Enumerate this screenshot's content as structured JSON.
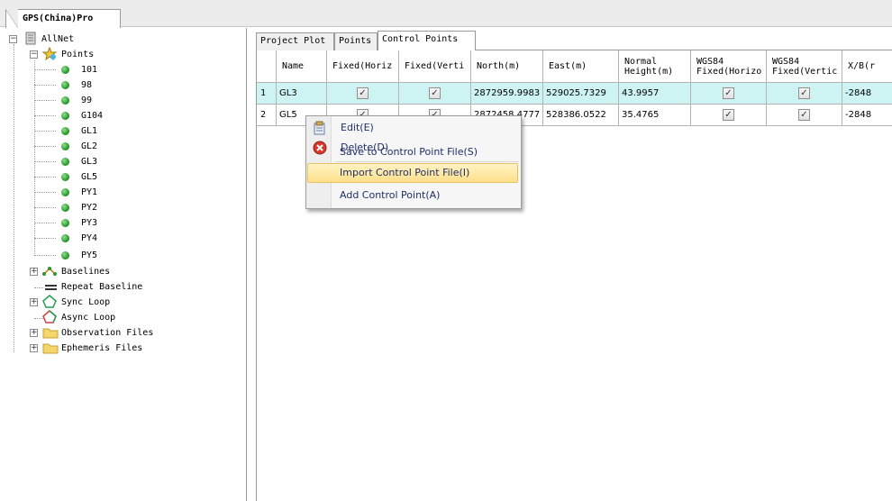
{
  "document_tab": {
    "label": "GPS(China)Pro"
  },
  "tree": {
    "root": "AllNet",
    "points_label": "Points",
    "points": [
      "101",
      "98",
      "99",
      "G104",
      "GL1",
      "GL2",
      "GL3",
      "GL5",
      "PY1",
      "PY2",
      "PY3",
      "PY4",
      "PY5"
    ],
    "baselines": "Baselines",
    "repeat_baseline": "Repeat Baseline",
    "sync_loop": "Sync Loop",
    "async_loop": "Async Loop",
    "observation_files": "Observation Files",
    "ephemeris_files": "Ephemeris Files"
  },
  "pane_tabs": [
    "Project Plot",
    "Points",
    "Control Points"
  ],
  "active_tab": "Control Points",
  "grid": {
    "columns": [
      {
        "line1": "Name",
        "line2": ""
      },
      {
        "line1": "Fixed(Horiz",
        "line2": ""
      },
      {
        "line1": "Fixed(Verti",
        "line2": ""
      },
      {
        "line1": "North(m)",
        "line2": ""
      },
      {
        "line1": "East(m)",
        "line2": ""
      },
      {
        "line1": "Normal",
        "line2": "Height(m)"
      },
      {
        "line1": "WGS84",
        "line2": "Fixed(Horizo"
      },
      {
        "line1": "WGS84",
        "line2": "Fixed(Vertic"
      },
      {
        "line1": "X/B(r",
        "line2": ""
      }
    ],
    "rows": [
      {
        "num": "1",
        "name": "GL3",
        "north": "2872959.9983",
        "east": "529025.7329",
        "height": "43.9957",
        "x": "-2848",
        "fixed_h": true,
        "fixed_v": true,
        "wgs_h": true,
        "wgs_v": true,
        "selected": true
      },
      {
        "num": "2",
        "name": "GL5",
        "north": "2872458.4777",
        "east": "528386.0522",
        "height": "35.4765",
        "x": "-2848",
        "fixed_h": true,
        "fixed_v": true,
        "wgs_h": true,
        "wgs_v": true,
        "selected": false
      }
    ]
  },
  "context_menu": {
    "edit": "Edit(E)",
    "delete": "Delete(D)",
    "save": "Save to Control Point File(S)",
    "import": "Import Control Point File(I)",
    "add": "Add Control Point(A)"
  },
  "colors": {
    "selection": "#cdf3f3",
    "menu_hover": "#ffe08a",
    "menu_text": "#1f2f6a"
  }
}
